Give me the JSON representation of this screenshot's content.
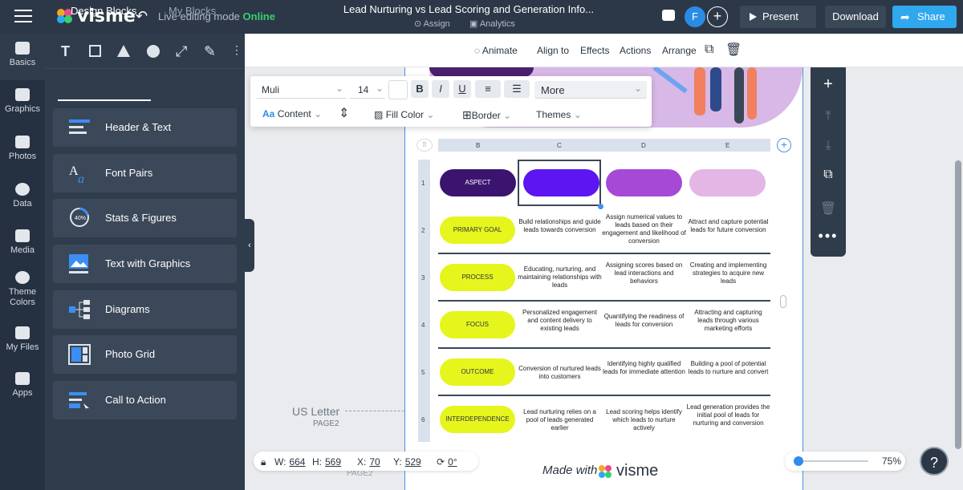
{
  "app": {
    "logo": "visme",
    "mode_label": "Live editing mode",
    "mode_status": "Online"
  },
  "header": {
    "title": "Lead Nurturing vs Lead Scoring and Generation Info...",
    "assign": "Assign",
    "analytics": "Analytics",
    "avatar_initial": "F",
    "present": "Present",
    "download": "Download",
    "share": "Share"
  },
  "rail": [
    {
      "label": "Basics",
      "icon": "shapes-icon"
    },
    {
      "label": "Graphics",
      "icon": "graphics-icon"
    },
    {
      "label": "Photos",
      "icon": "photo-icon"
    },
    {
      "label": "Data",
      "icon": "pie-chart-icon"
    },
    {
      "label": "Media",
      "icon": "video-icon"
    },
    {
      "label": "Theme Colors",
      "icon": "palette-icon"
    },
    {
      "label": "My Files",
      "icon": "upload-icon"
    },
    {
      "label": "Apps",
      "icon": "apps-icon"
    }
  ],
  "panel": {
    "tab_design": "Design Blocks",
    "tab_my": "My Blocks",
    "blocks": [
      "Header & Text",
      "Font Pairs",
      "Stats & Figures",
      "Text with Graphics",
      "Diagrams",
      "Photo Grid",
      "Call to Action"
    ]
  },
  "edit_toolbar": {
    "animate": "Animate",
    "align": "Align to",
    "effects": "Effects",
    "actions": "Actions",
    "arrange": "Arrange"
  },
  "text_toolbar": {
    "font": "Muli",
    "size": "14",
    "more": "More",
    "content": "Content",
    "fill": "Fill Color",
    "border": "Border",
    "themes": "Themes",
    "bold": "B",
    "italic": "I",
    "underline": "U"
  },
  "canvas": {
    "us_letter": "US Letter",
    "page_label": "PAGE2"
  },
  "table": {
    "columns": [
      "B",
      "C",
      "D",
      "E"
    ],
    "rows": [
      "1",
      "2",
      "3",
      "4",
      "5",
      "6"
    ],
    "header_pill": "ASPECT",
    "aspects": [
      "PRIMARY GOAL",
      "PROCESS",
      "FOCUS",
      "OUTCOME",
      "INTERDEPENDENCE"
    ],
    "col_c": [
      "Build relationships and guide leads towards conversion",
      "Educating, nurturing, and maintaining relationships with leads",
      "Personalized engagement and content delivery to existing leads",
      "Conversion of nurtured leads into customers",
      "Lead nurturing relies on a pool of leads generated earlier"
    ],
    "col_d": [
      "Assign numerical values to leads based on their engagement and likelihood of conversion",
      "Assigning scores based on lead interactions and behaviors",
      "Quantifying the readiness of leads for conversion",
      "Identifying highly qualified leads for immediate attention",
      "Lead scoring helps identify which leads to nurture actively"
    ],
    "col_e": [
      "Attract and capture potential leads for future conversion",
      "Creating and implementing strategies to acquire new leads",
      "Attracting and capturing leads through various marketing efforts",
      "Building a pool of potential leads to nurture and convert",
      "Lead generation provides the initial pool of leads for nurturing and conversion"
    ]
  },
  "footer": {
    "made_with": "Made with",
    "brand": "visme"
  },
  "geometry_readout": {
    "w_label": "W:",
    "w": "664",
    "h_label": "H:",
    "h": "569",
    "x_label": "X:",
    "x": "70",
    "y_label": "Y:",
    "y": "529",
    "rotation": "0°"
  },
  "zoom": {
    "value": "75%",
    "level": 0.05
  },
  "help": "?",
  "colors": {
    "topbar": "#2c3847",
    "aspect_header": "#3b1470",
    "col_c_header": "#5b16f2",
    "col_d_header": "#a649d6",
    "col_e_header": "#e3b6e6",
    "aspect_pill": "#e6f51c",
    "online": "#36d16e",
    "share": "#2fa8ee"
  }
}
